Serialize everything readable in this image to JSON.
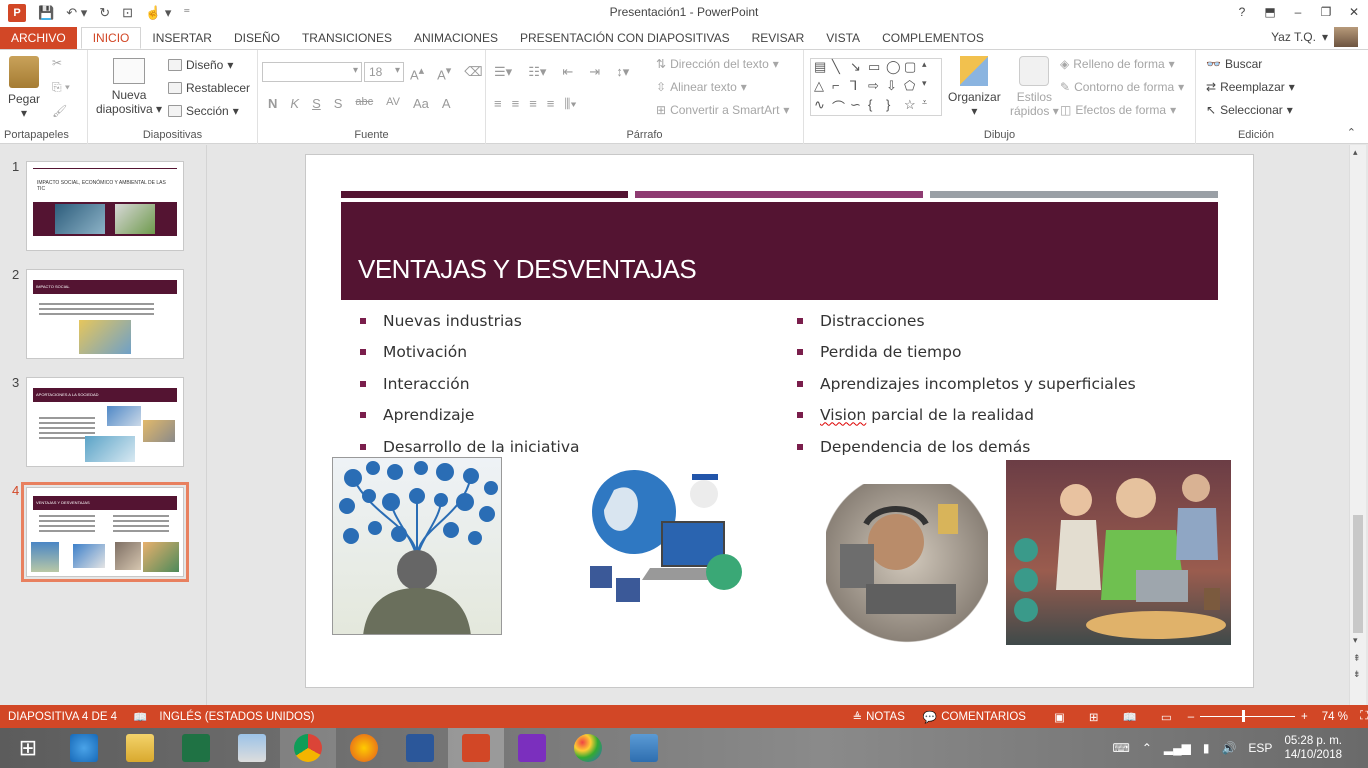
{
  "window": {
    "title": "Presentación1 - PowerPoint",
    "help": "?",
    "minimize": "–",
    "restore": "❐",
    "close": "✕"
  },
  "tabs": [
    "ARCHIVO",
    "INICIO",
    "INSERTAR",
    "DISEÑO",
    "TRANSICIONES",
    "ANIMACIONES",
    "PRESENTACIÓN CON DIAPOSITIVAS",
    "REVISAR",
    "VISTA",
    "COMPLEMENTOS"
  ],
  "user": {
    "name": "Yaz T.Q."
  },
  "ribbon": {
    "clipboard": {
      "paste": "Pegar",
      "label": "Portapapeles"
    },
    "slides": {
      "new_slide": "Nueva",
      "new_slide2": "diapositiva",
      "design": "Diseño",
      "reset": "Restablecer",
      "section": "Sección",
      "label": "Diapositivas"
    },
    "font": {
      "size": "18",
      "label": "Fuente",
      "buttons": [
        "N",
        "K",
        "S",
        "S",
        "abc",
        "AV",
        "Aa",
        "A"
      ]
    },
    "paragraph": {
      "text_direction": "Dirección del texto",
      "align_text": "Alinear texto",
      "smartart": "Convertir a SmartArt",
      "label": "Párrafo"
    },
    "drawing": {
      "arrange": "Organizar",
      "quick_styles": "Estilos",
      "quick_styles2": "rápidos",
      "fill": "Relleno de forma",
      "outline": "Contorno de forma",
      "effects": "Efectos de forma",
      "label": "Dibujo"
    },
    "editing": {
      "find": "Buscar",
      "replace": "Reemplazar",
      "select": "Seleccionar",
      "label": "Edición"
    }
  },
  "thumbnails": [
    {
      "num": "1",
      "title": "IMPACTO SOCIAL, ECONÓMICO Y AMBIENTAL DE LAS TIC"
    },
    {
      "num": "2",
      "title": "IMPACTO SOCIAL"
    },
    {
      "num": "3",
      "title": "APORTACIONES A LA SOCIEDAD"
    },
    {
      "num": "4",
      "title": "VENTAJAS Y DESVENTAJAS"
    }
  ],
  "slide": {
    "title": "VENTAJAS Y DESVENTAJAS",
    "left": [
      "Nuevas industrias",
      "Motivación",
      "Interacción",
      "Aprendizaje",
      "Desarrollo de la iniciativa"
    ],
    "right": [
      "Distracciones",
      "Perdida de tiempo",
      "Aprendizajes incompletos y superficiales",
      "Vision",
      "parcial de la realidad",
      "Dependencia de los demás"
    ],
    "colors": {
      "primary": "#541432",
      "accent": "#8e3b72",
      "gray": "#9aa0a6"
    }
  },
  "status": {
    "slide": "DIAPOSITIVA 4 DE 4",
    "language": "INGLÉS (ESTADOS UNIDOS)",
    "notes": "NOTAS",
    "comments": "COMENTARIOS",
    "zoom": "74 %"
  },
  "tray": {
    "lang": "ESP",
    "time": "05:28 p. m.",
    "date": "14/10/2018"
  }
}
